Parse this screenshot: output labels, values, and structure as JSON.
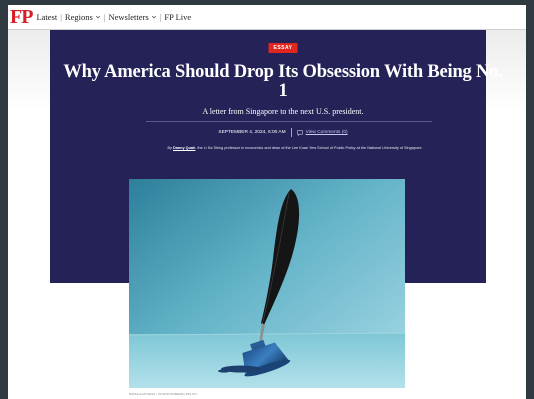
{
  "nav": {
    "logo": "FP",
    "links": [
      "Latest",
      "Regions",
      "Newsletters",
      "FP Live"
    ]
  },
  "article": {
    "badge": "ESSAY",
    "title": "Why America Should Drop Its Obsession With Being No. 1",
    "subtitle": "A letter from Singapore to the next U.S. president.",
    "date": "SEPTEMBER 4, 2024, 6:00 AM",
    "comments_label": "View Comments (0)",
    "byline_prefix": "By ",
    "author": "Danny Quah",
    "byline_rest": ", the Li Ka Shing professor in economics and dean of the Lee Kuan Yew School of Public Policy at the National University of Singapore.",
    "image_credit": "NATALIA MYCEVA / ISTOCK/FOREIGN POLICY"
  },
  "colors": {
    "hero_bg": "#242257",
    "brand_red": "#d71f26",
    "badge_red": "#e0261f",
    "frame": "#2e3a3f"
  },
  "icons": {
    "comment": "comment-bubble-icon",
    "dropdown": "chevron-down-icon"
  }
}
